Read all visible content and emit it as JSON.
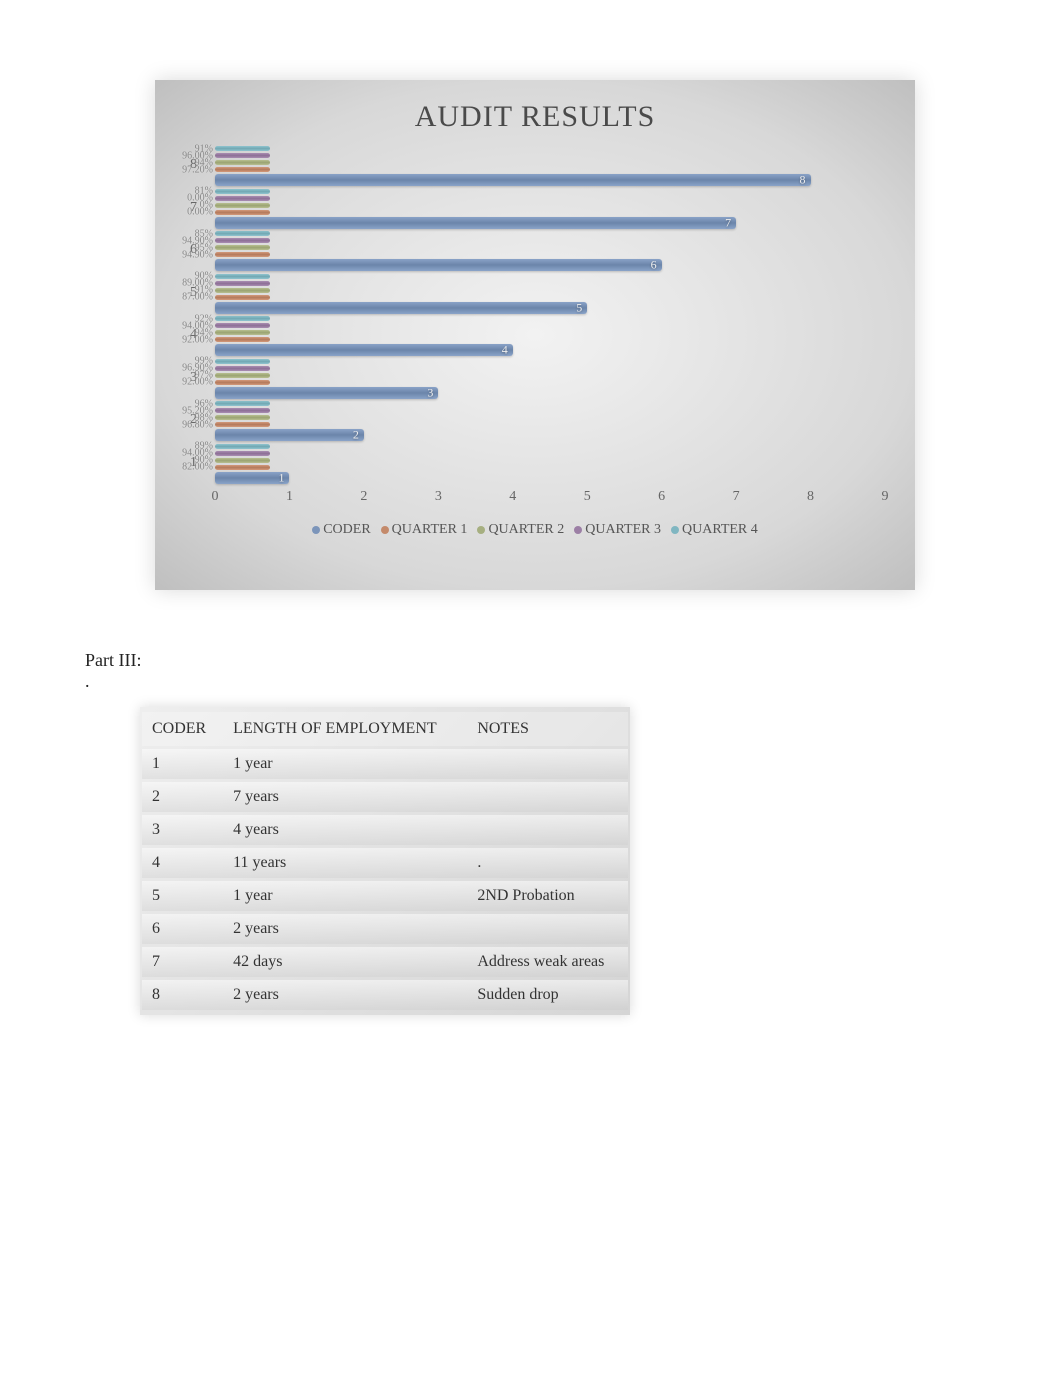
{
  "chart_data": {
    "type": "bar",
    "orientation": "horizontal",
    "title": "AUDIT RESULTS",
    "x": {
      "min": 0,
      "max": 9,
      "ticks": [
        0,
        1,
        2,
        3,
        4,
        5,
        6,
        7,
        8,
        9
      ]
    },
    "y": {
      "ticks": [
        1,
        2,
        3,
        4,
        5,
        6,
        7,
        8
      ]
    },
    "series": [
      {
        "name": "CODER",
        "color": "#7c95ba",
        "values": [
          1,
          2,
          3,
          4,
          5,
          6,
          7,
          8
        ]
      },
      {
        "name": "QUARTER 1",
        "color": "#c48a6b",
        "values_label": [
          "82.00%",
          "96.80%",
          "92.00%",
          "92.00%",
          "87.00%",
          "94.90%",
          "0.00%",
          "97.20%"
        ]
      },
      {
        "name": "QUARTER 2",
        "color": "#a6af80",
        "values_label": [
          "90%",
          "98%",
          "97%",
          "94%",
          "91%",
          "95%",
          "0%",
          "94%"
        ]
      },
      {
        "name": "QUARTER 3",
        "color": "#9c7fa5",
        "values_label": [
          "94.00%",
          "95.20%",
          "96.90%",
          "94.00%",
          "89.00%",
          "94.90%",
          "0.00%",
          "96.00%"
        ]
      },
      {
        "name": "QUARTER 4",
        "color": "#80b6c1",
        "values_label": [
          "89%",
          "96%",
          "99%",
          "92%",
          "90%",
          "85%",
          "81%",
          "91%"
        ]
      }
    ],
    "legend": [
      "CODER",
      "QUARTER 1",
      "QUARTER 2",
      "QUARTER 3",
      "QUARTER 4"
    ]
  },
  "section": {
    "heading": "Part III:",
    "bullet": "."
  },
  "table": {
    "headers": [
      "CODER",
      "LENGTH OF EMPLOYMENT",
      "NOTES"
    ],
    "rows": [
      {
        "coder": "1",
        "length": "1 year",
        "notes": ""
      },
      {
        "coder": "2",
        "length": "7 years",
        "notes": ""
      },
      {
        "coder": "3",
        "length": "4 years",
        "notes": ""
      },
      {
        "coder": "4",
        "length": "11 years",
        "notes": "."
      },
      {
        "coder": "5",
        "length": "1 year",
        "notes": "2ND Probation"
      },
      {
        "coder": "6",
        "length": "2 years",
        "notes": ""
      },
      {
        "coder": "7",
        "length": "42 days",
        "notes": "Address weak areas"
      },
      {
        "coder": "8",
        "length": "2 years",
        "notes": "Sudden drop"
      }
    ]
  }
}
